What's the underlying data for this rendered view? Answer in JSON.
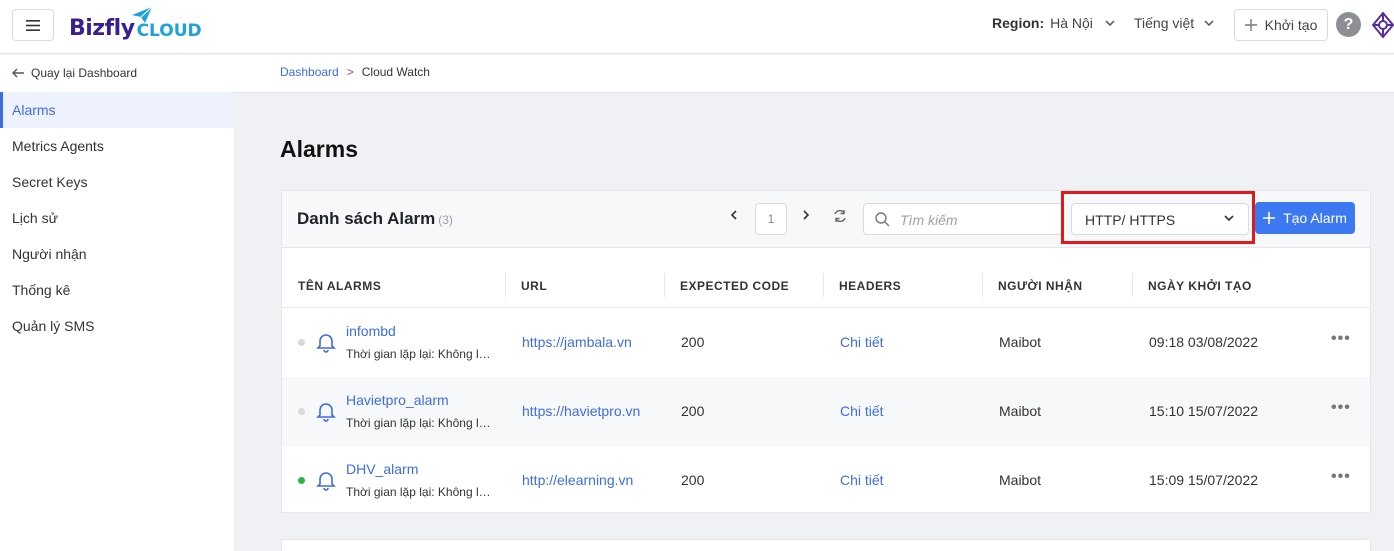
{
  "header": {
    "logo_biz": "Bizfly",
    "logo_cloud": "CLOUD",
    "region_label": "Region:",
    "region_value": "Hà Nội",
    "language": "Tiếng việt",
    "create_label": "Khởi tạo",
    "help_label": "?"
  },
  "sidebar": {
    "back_label": "Quay lại Dashboard",
    "items": [
      {
        "label": "Alarms"
      },
      {
        "label": "Metrics Agents"
      },
      {
        "label": "Secret Keys"
      },
      {
        "label": "Lịch sử"
      },
      {
        "label": "Người nhận"
      },
      {
        "label": "Thống kê"
      },
      {
        "label": "Quản lý SMS"
      }
    ]
  },
  "breadcrumb": {
    "root": "Dashboard",
    "separator": ">",
    "current": "Cloud Watch"
  },
  "page_title": "Alarms",
  "card": {
    "title": "Danh sách Alarm",
    "count": "(3)",
    "page_number": "1",
    "search_placeholder": "Tìm kiếm",
    "filter_value": "HTTP/ HTTPS",
    "add_button": "Tạo Alarm"
  },
  "table": {
    "columns": [
      "TÊN ALARMS",
      "URL",
      "EXPECTED CODE",
      "HEADERS",
      "NGƯỜI NHẬN",
      "NGÀY KHỞI TẠO"
    ],
    "rows": [
      {
        "name": "infombd",
        "sub": "Thời gian lặp lại: Không lặp lại",
        "url": "https://jambala.vn",
        "code": "200",
        "headers": "Chi tiết",
        "recipient": "Maibot",
        "created": "09:18 03/08/2022",
        "status_color": "#d9d9d9",
        "more": "•••"
      },
      {
        "name": "Havietpro_alarm",
        "sub": "Thời gian lặp lại: Không lặp lại",
        "url": "https://havietpro.vn",
        "code": "200",
        "headers": "Chi tiết",
        "recipient": "Maibot",
        "created": "15:10 15/07/2022",
        "status_color": "#d9d9d9",
        "more": "•••"
      },
      {
        "name": "DHV_alarm",
        "sub": "Thời gian lặp lại: Không lặp lại",
        "url": "http://elearning.vn",
        "code": "200",
        "headers": "Chi tiết",
        "recipient": "Maibot",
        "created": "15:09 15/07/2022",
        "status_color": "#2bb34a",
        "more": "•••"
      }
    ]
  },
  "colors": {
    "accent": "#3c78f0",
    "highlight_box": "#e0191c"
  }
}
